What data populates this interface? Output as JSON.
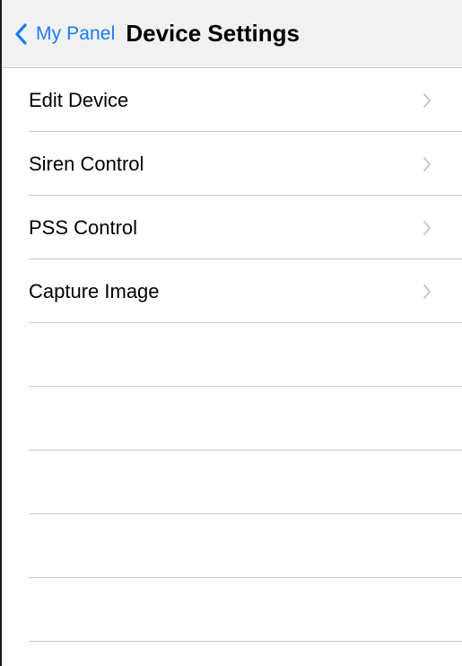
{
  "nav": {
    "back_label": "My Panel",
    "title": "Device Settings",
    "back_icon": "chevron-left-icon",
    "accent_color": "#1a7cf5"
  },
  "settings": {
    "items": [
      {
        "label": "Edit Device",
        "icon": "chevron-right-icon"
      },
      {
        "label": "Siren Control",
        "icon": "chevron-right-icon"
      },
      {
        "label": "PSS Control",
        "icon": "chevron-right-icon"
      },
      {
        "label": "Capture Image",
        "icon": "chevron-right-icon"
      }
    ]
  },
  "colors": {
    "nav_background": "#f1f1f2",
    "separator": "#c8c7cc",
    "chevron": "#c7c7cc"
  }
}
